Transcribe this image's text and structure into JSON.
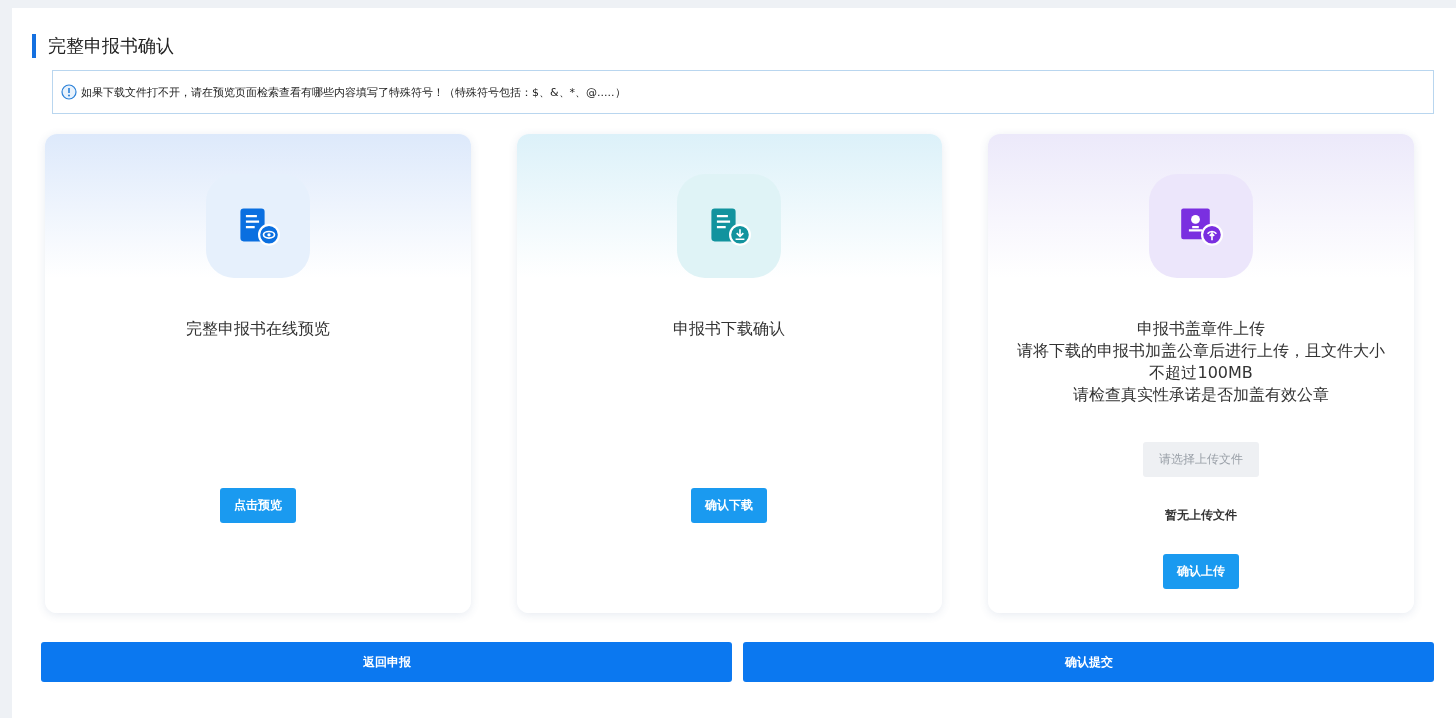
{
  "page_title": "完整申报书确认",
  "notice": "如果下载文件打不开，请在预览页面检索查看有哪些内容填写了特殊符号！（特殊符号包括：$、&、*、@.....）",
  "cards": [
    {
      "kind": "preview",
      "lines": [
        "完整申报书在线预览"
      ],
      "button": "点击预览"
    },
    {
      "kind": "download",
      "lines": [
        "申报书下载确认"
      ],
      "button": "确认下载"
    },
    {
      "kind": "upload",
      "lines": [
        "申报书盖章件上传",
        "请将下载的申报书加盖公章后进行上传，且文件大小不超过100MB",
        "请检查真实性承诺是否加盖有效公章"
      ],
      "file_picker": {
        "label": "请选择上传文件",
        "disabled": true
      },
      "file_status": "暂无上传文件",
      "button": "确认上传"
    }
  ],
  "actions": [
    "返回申报",
    "确认提交"
  ]
}
